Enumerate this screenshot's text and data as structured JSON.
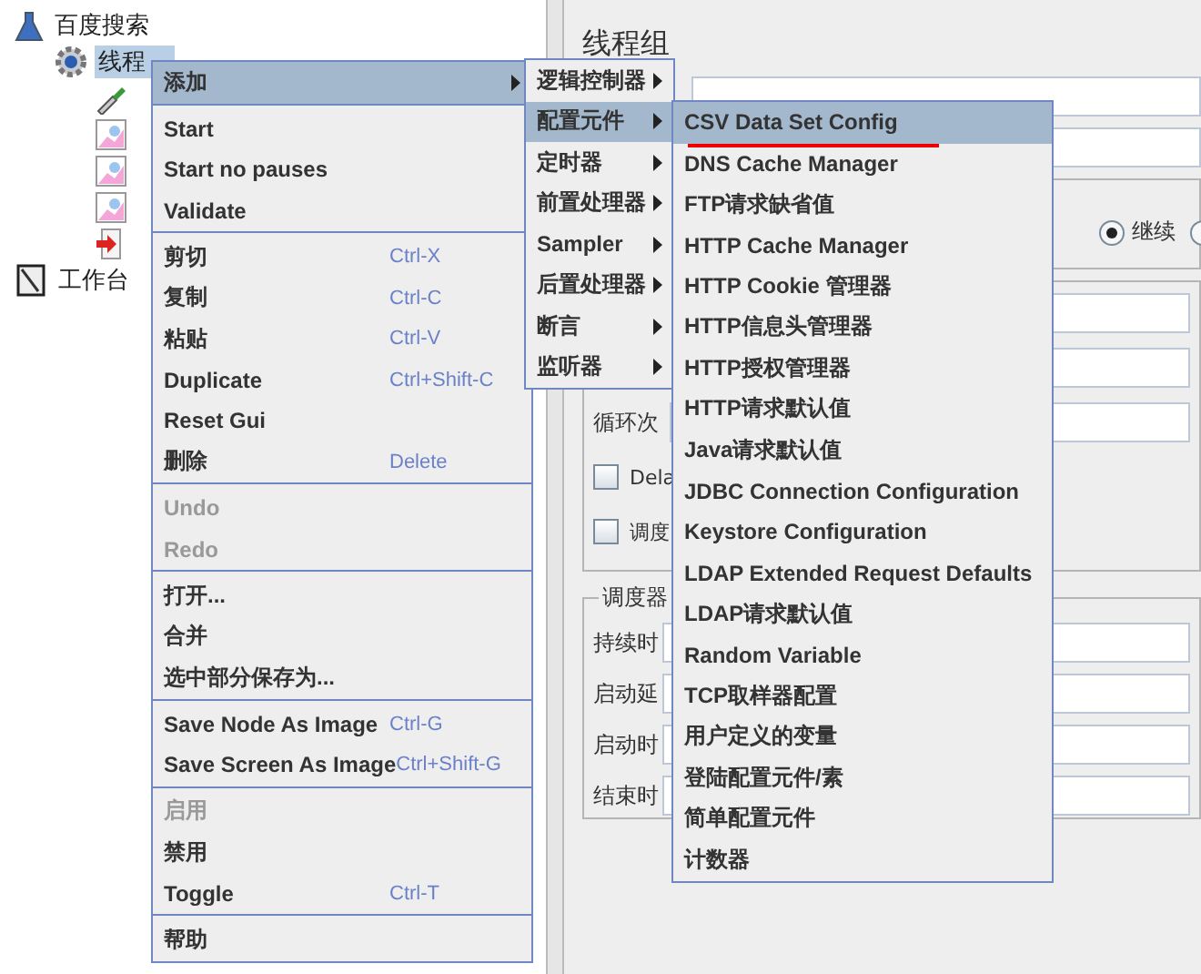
{
  "tree": [
    {
      "label": "百度搜索",
      "kind": "flask",
      "selected": false,
      "children": [
        {
          "label": "线程",
          "kind": "gear",
          "selected": true,
          "children": [
            {
              "kind": "pipette"
            },
            {
              "kind": "graph"
            },
            {
              "kind": "graph"
            },
            {
              "kind": "graph"
            },
            {
              "kind": "doc-arrow"
            }
          ]
        }
      ]
    },
    {
      "label": "工作台",
      "kind": "notebook",
      "selected": false
    }
  ],
  "panel": {
    "title": "线程组",
    "error_action": {
      "options": [
        {
          "label": "继续",
          "selected": true
        },
        {
          "selected": false
        }
      ]
    },
    "thread_properties": {
      "loop_label": "循环次",
      "checkboxes": [
        {
          "label": "Dela",
          "checked": false
        },
        {
          "label": "调度",
          "checked": false
        }
      ]
    },
    "scheduler": {
      "title": "调度器",
      "rows": [
        "持续时",
        "启动延",
        "启动时",
        "结束时"
      ]
    }
  },
  "context_menu": {
    "items": [
      {
        "kind": "item",
        "label": "添加",
        "selected": true,
        "has_submenu": true
      },
      {
        "kind": "separator"
      },
      {
        "kind": "item",
        "label": "Start"
      },
      {
        "kind": "item",
        "label": "Start no pauses"
      },
      {
        "kind": "item",
        "label": "Validate"
      },
      {
        "kind": "separator"
      },
      {
        "kind": "item",
        "label": "剪切",
        "shortcut": "Ctrl-X"
      },
      {
        "kind": "item",
        "label": "复制",
        "shortcut": "Ctrl-C"
      },
      {
        "kind": "item",
        "label": "粘贴",
        "shortcut": "Ctrl-V"
      },
      {
        "kind": "item",
        "label": "Duplicate",
        "shortcut": "Ctrl+Shift-C"
      },
      {
        "kind": "item",
        "label": "Reset Gui"
      },
      {
        "kind": "item",
        "label": "删除",
        "shortcut": "Delete"
      },
      {
        "kind": "separator"
      },
      {
        "kind": "item",
        "label": "Undo",
        "disabled": true
      },
      {
        "kind": "item",
        "label": "Redo",
        "disabled": true
      },
      {
        "kind": "separator"
      },
      {
        "kind": "item",
        "label": "打开..."
      },
      {
        "kind": "item",
        "label": "合并"
      },
      {
        "kind": "item",
        "label": "选中部分保存为..."
      },
      {
        "kind": "separator"
      },
      {
        "kind": "item",
        "label": "Save Node As Image",
        "shortcut": "Ctrl-G"
      },
      {
        "kind": "item",
        "label": "Save Screen As Image",
        "shortcut": "Ctrl+Shift-G"
      },
      {
        "kind": "separator"
      },
      {
        "kind": "item",
        "label": "启用",
        "disabled": true
      },
      {
        "kind": "item",
        "label": "禁用"
      },
      {
        "kind": "item",
        "label": "Toggle",
        "shortcut": "Ctrl-T"
      },
      {
        "kind": "separator"
      },
      {
        "kind": "item",
        "label": "帮助"
      }
    ]
  },
  "submenus": [
    {
      "items": [
        {
          "kind": "item",
          "label": "逻辑控制器",
          "has_submenu": true
        },
        {
          "kind": "item",
          "label": "配置元件",
          "selected": true,
          "has_submenu": true
        },
        {
          "kind": "item",
          "label": "定时器",
          "has_submenu": true
        },
        {
          "kind": "item",
          "label": "前置处理器",
          "has_submenu": true
        },
        {
          "kind": "item",
          "label": "Sampler",
          "has_submenu": true
        },
        {
          "kind": "item",
          "label": "后置处理器",
          "has_submenu": true
        },
        {
          "kind": "item",
          "label": "断言",
          "has_submenu": true
        },
        {
          "kind": "item",
          "label": "监听器",
          "has_submenu": true
        }
      ]
    },
    {
      "items": [
        {
          "kind": "item",
          "label": "CSV Data Set Config",
          "selected": true,
          "underlined": true
        },
        {
          "kind": "item",
          "label": "DNS Cache Manager"
        },
        {
          "kind": "item",
          "label": "FTP请求缺省值"
        },
        {
          "kind": "item",
          "label": "HTTP Cache Manager"
        },
        {
          "kind": "item",
          "label": "HTTP Cookie 管理器"
        },
        {
          "kind": "item",
          "label": "HTTP信息头管理器"
        },
        {
          "kind": "item",
          "label": "HTTP授权管理器"
        },
        {
          "kind": "item",
          "label": "HTTP请求默认值"
        },
        {
          "kind": "item",
          "label": "Java请求默认值"
        },
        {
          "kind": "item",
          "label": "JDBC Connection Configuration"
        },
        {
          "kind": "item",
          "label": "Keystore Configuration"
        },
        {
          "kind": "item",
          "label": "LDAP Extended Request Defaults"
        },
        {
          "kind": "item",
          "label": "LDAP请求默认值"
        },
        {
          "kind": "item",
          "label": "Random Variable"
        },
        {
          "kind": "item",
          "label": "TCP取样器配置"
        },
        {
          "kind": "item",
          "label": "用户定义的变量"
        },
        {
          "kind": "item",
          "label": "登陆配置元件/素"
        },
        {
          "kind": "item",
          "label": "简单配置元件"
        },
        {
          "kind": "item",
          "label": "计数器"
        }
      ]
    }
  ]
}
